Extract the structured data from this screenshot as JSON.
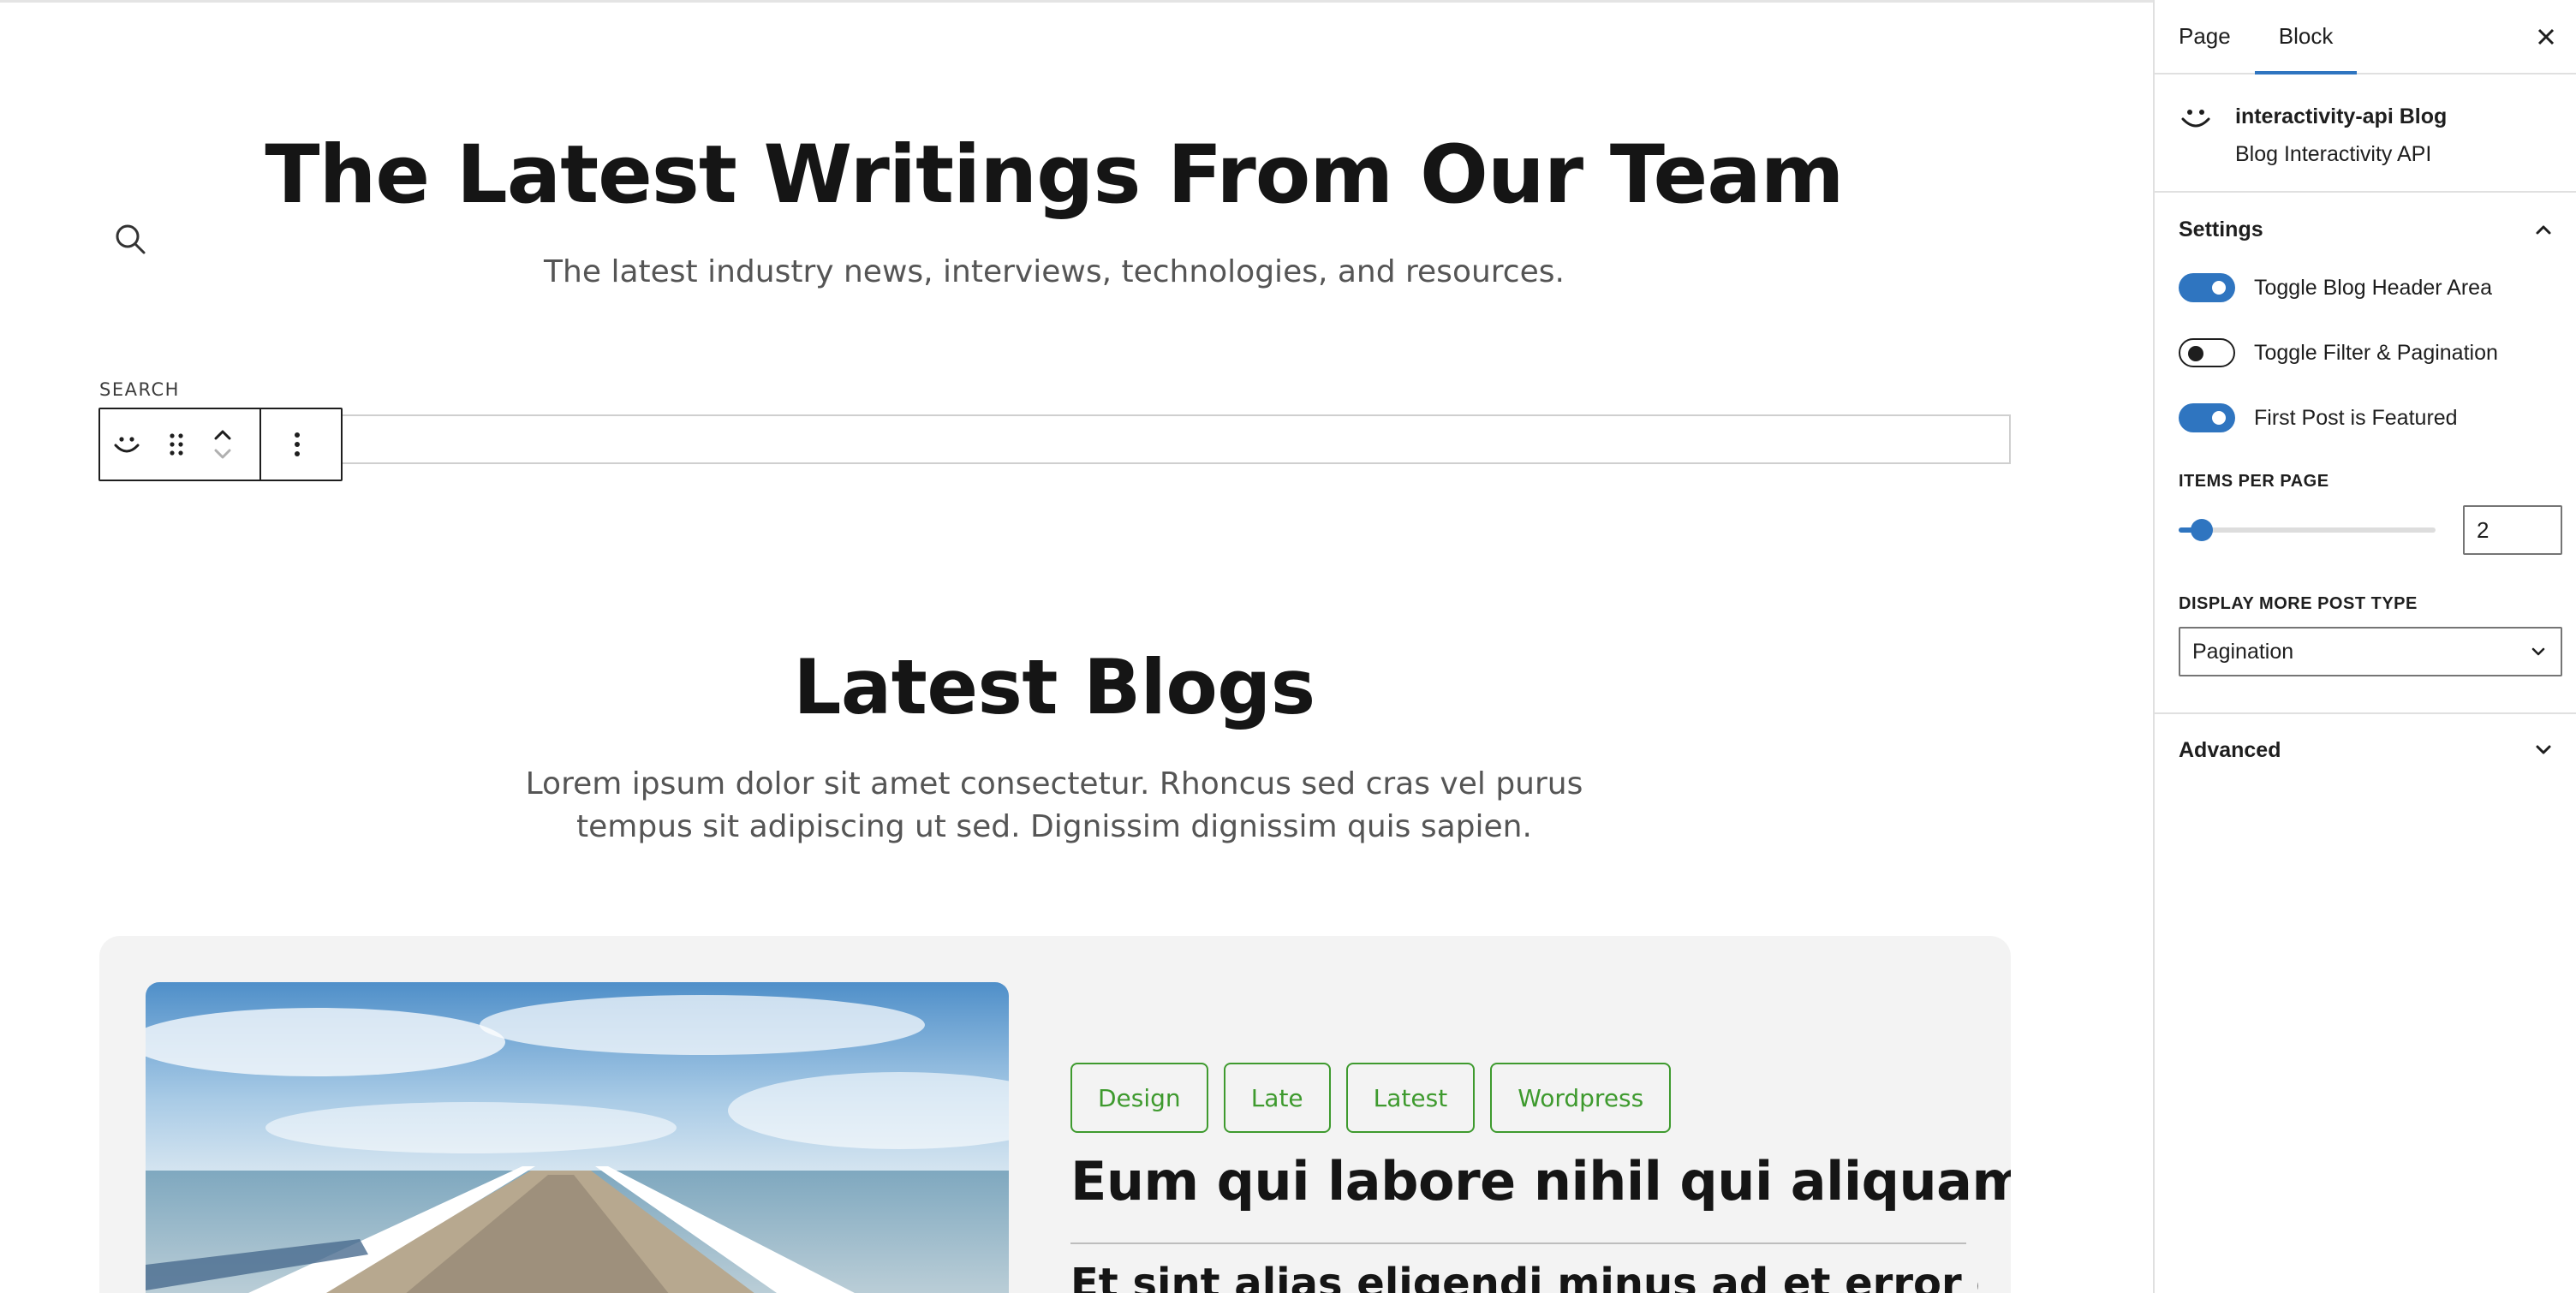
{
  "hero": {
    "title": "The Latest Writings From Our Team",
    "subtitle": "The latest industry news, interviews, technologies, and resources."
  },
  "search": {
    "label": "SEARCH",
    "value": "",
    "placeholder": ""
  },
  "block_toolbar": {
    "icons": [
      "block-type-smile-icon",
      "drag-handle-icon",
      "move-up-icon",
      "move-down-icon",
      "more-options-icon"
    ]
  },
  "section": {
    "title": "Latest Blogs",
    "description_lines": [
      "Lorem ipsum dolor sit amet consectetur. Rhoncus sed cras vel purus",
      "tempus sit adipiscing ut sed. Dignissim dignissim quis sapien."
    ]
  },
  "featured_post": {
    "tags": [
      "Design",
      "Late",
      "Latest",
      "Wordpress"
    ],
    "title": "Eum qui labore nihil qui aliquam ea",
    "excerpt": "Et sint alias eligendi minus ad et error et. Dolor",
    "image": "pier-over-ocean-photo"
  },
  "sidebar": {
    "tabs": [
      {
        "label": "Page",
        "active": false
      },
      {
        "label": "Block",
        "active": true
      }
    ],
    "block": {
      "name": "interactivity-api Blog",
      "description": "Blog Interactivity API"
    },
    "settings": {
      "title": "Settings",
      "toggles": [
        {
          "label": "Toggle Blog Header Area",
          "checked": true
        },
        {
          "label": "Toggle Filter & Pagination",
          "checked": false
        },
        {
          "label": "First Post is Featured",
          "checked": true
        }
      ],
      "items_per_page": {
        "label": "ITEMS PER PAGE",
        "value": "2",
        "slider_fraction": 0.09
      },
      "display_more": {
        "label": "DISPLAY MORE POST TYPE",
        "selected": "Pagination"
      }
    },
    "advanced": {
      "title": "Advanced"
    }
  },
  "colors": {
    "accent": "#2f75c0",
    "tag_green": "#3e9a2e",
    "card_bg": "#f3f3f3"
  }
}
